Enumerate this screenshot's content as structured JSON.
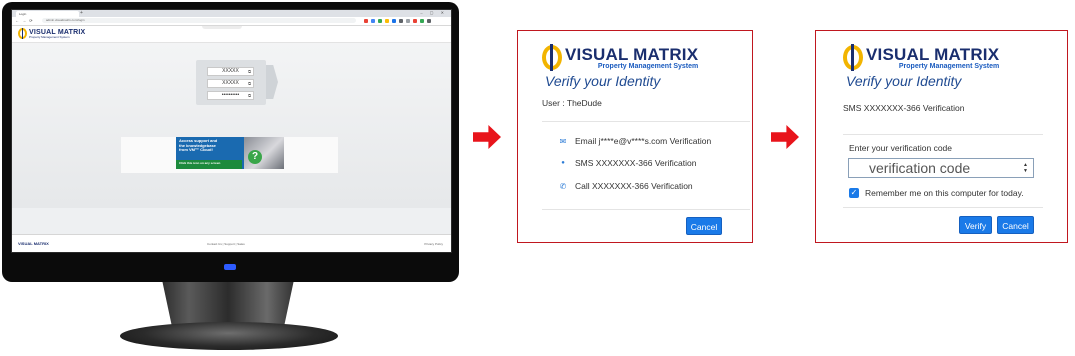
{
  "colors": {
    "accent_blue": "#1a7ae8",
    "brand_navy": "#1a2e6e",
    "brand_gold": "#f2b400",
    "arrow_red": "#e8141b",
    "dialog_border": "#c0171f"
  },
  "monitor": {
    "browser": {
      "tab_title": "Login",
      "new_tab": "+",
      "window_controls": "–  ▢  ✕",
      "nav_buttons": "←  →  ⟳",
      "url": "admin.visualmatrix.com/login",
      "extension_colors": [
        "#e94235",
        "#4285f4",
        "#34a853",
        "#fbbc05",
        "#1a73e8",
        "#5f6368",
        "#9aa0a6",
        "#e94235",
        "#34a853",
        "#5f6368"
      ]
    },
    "site": {
      "logo_brand": "VISUAL MATRIX",
      "logo_tag": "Property Management System",
      "login_fields": [
        {
          "value": "XXXXX",
          "icon": "user-icon",
          "glyph": "⧉"
        },
        {
          "value": "XXXXX",
          "icon": "property-icon",
          "glyph": "⧉"
        },
        {
          "value": "••••••••••",
          "icon": "password-icon",
          "glyph": "⧉"
        }
      ],
      "banner_text": "Access support and\nthe knowledgebase\nfrom VM™ Cloud!",
      "banner_cta": "Click this icon on any screen",
      "banner_glyph": "?",
      "footer_left": "VISUAL MATRIX",
      "footer_center": "Contact Us | Support | Sales",
      "footer_right": "Privacy Policy"
    }
  },
  "dialog1": {
    "logo_brand": "VISUAL MATRIX",
    "logo_tag": "Property Management System",
    "title": "Verify your Identity",
    "user_line": "User : TheDude",
    "options": [
      {
        "icon": "envelope-icon",
        "glyph": "✉",
        "label": "Email j****e@v****s.com Verification"
      },
      {
        "icon": "chat-bubble-icon",
        "glyph": "●",
        "label": "SMS XXXXXXX-366 Verification"
      },
      {
        "icon": "phone-icon",
        "glyph": "✆",
        "label": "Call XXXXXXX-366 Verification"
      }
    ],
    "cancel_label": "Cancel"
  },
  "dialog2": {
    "logo_brand": "VISUAL MATRIX",
    "logo_tag": "Property Management System",
    "title": "Verify your Identity",
    "method_line": "SMS XXXXXXX-366 Verification",
    "code_label": "Enter your verification code",
    "code_placeholder": "verification code",
    "spinner_glyph": "▲\n▼",
    "remember_checked": true,
    "remember_glyph": "✓",
    "remember_label": "Remember me on this computer for today.",
    "verify_label": "Verify",
    "cancel_label": "Cancel"
  }
}
